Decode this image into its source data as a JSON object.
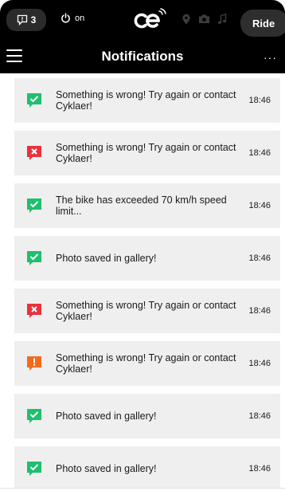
{
  "statusbar": {
    "notification_count": "3",
    "power_label": "on",
    "ride_label": "Ride"
  },
  "header": {
    "title": "Notifications",
    "more_label": "···"
  },
  "colors": {
    "success": "#1fbf6e",
    "error": "#e8323c",
    "warning": "#f26b1d",
    "card": "#efefef"
  },
  "notifications": [
    {
      "type": "success",
      "icon": "check-icon",
      "message": "Something is wrong! Try again or contact Cyklaer!",
      "time": "18:46"
    },
    {
      "type": "error",
      "icon": "x-icon",
      "message": "Something is wrong! Try again or contact Cyklaer!",
      "time": "18:46"
    },
    {
      "type": "success",
      "icon": "check-icon",
      "message": "The bike has exceeded 70 km/h speed limit...",
      "time": "18:46"
    },
    {
      "type": "success",
      "icon": "check-icon",
      "message": "Photo saved in gallery!",
      "time": "18:46"
    },
    {
      "type": "error",
      "icon": "x-icon",
      "message": "Something is wrong! Try again or contact Cyklaer!",
      "time": "18:46"
    },
    {
      "type": "warning",
      "icon": "exclamation-icon",
      "message": "Something is wrong! Try again or contact Cyklaer!",
      "time": "18:46"
    },
    {
      "type": "success",
      "icon": "check-icon",
      "message": "Photo saved in gallery!",
      "time": "18:46"
    },
    {
      "type": "success",
      "icon": "check-icon",
      "message": "Photo saved in gallery!",
      "time": "18:46"
    }
  ]
}
